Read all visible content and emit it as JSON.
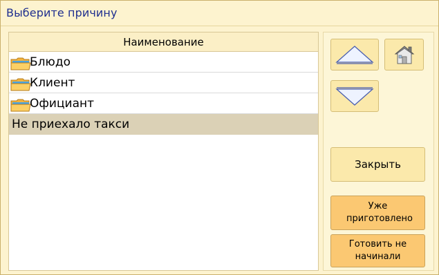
{
  "window": {
    "title": "Выберите причину"
  },
  "list": {
    "header": "Наименование",
    "items": [
      {
        "label": "Блюдо",
        "icon": "folder-icon",
        "selected": false
      },
      {
        "label": "Клиент",
        "icon": "folder-icon",
        "selected": false
      },
      {
        "label": "Официант",
        "icon": "folder-icon",
        "selected": false
      },
      {
        "label": "Не приехало такси",
        "icon": "",
        "selected": true
      }
    ]
  },
  "buttons": {
    "up_icon": "arrow-up-icon",
    "home_icon": "home-icon",
    "down_icon": "arrow-down-icon",
    "close_label": "Закрыть",
    "already_cooked_label": "Уже приготовлено",
    "not_started_label": "Готовить не начинали"
  },
  "colors": {
    "title_text": "#1f2f8f",
    "panel_background": "#fdf3cf",
    "selected_row": "#dbd1b6",
    "orange_button": "#fbc872",
    "yellow_button": "#fbe9ab"
  }
}
